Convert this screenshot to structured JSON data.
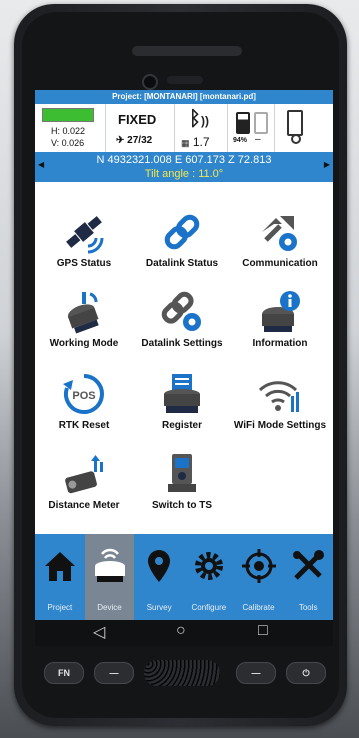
{
  "title_bar": "Project: [MONTANARI] [montanari.pd]",
  "status": {
    "h_value": "H: 0.022",
    "v_value": "V: 0.026",
    "fix_state": "FIXED",
    "satellites": "27/32",
    "pdop": "1.7",
    "battery": "94%",
    "battery2": "–"
  },
  "coords": "N 4932321.008 E 607.173 Z 72.813",
  "tilt": "Tilt angle : 11.0°",
  "menu": [
    {
      "label": "GPS Status",
      "icon": "satellite-icon"
    },
    {
      "label": "Datalink Status",
      "icon": "link-icon"
    },
    {
      "label": "Communication",
      "icon": "communication-gear-icon"
    },
    {
      "label": "Working Mode",
      "icon": "receiver-mode-icon"
    },
    {
      "label": "Datalink Settings",
      "icon": "link-gear-icon"
    },
    {
      "label": "Information",
      "icon": "receiver-info-icon"
    },
    {
      "label": "RTK Reset",
      "icon": "pos-reset-icon"
    },
    {
      "label": "Register",
      "icon": "register-icon"
    },
    {
      "label": "WiFi Mode Settings",
      "icon": "wifi-icon"
    },
    {
      "label": "Distance Meter",
      "icon": "distance-meter-icon"
    },
    {
      "label": "Switch to TS",
      "icon": "total-station-icon"
    }
  ],
  "nav": [
    {
      "label": "Project",
      "icon": "home-icon",
      "active": false
    },
    {
      "label": "Device",
      "icon": "receiver-icon",
      "active": true
    },
    {
      "label": "Survey",
      "icon": "location-pin-icon",
      "active": false
    },
    {
      "label": "Configure",
      "icon": "gear-icon",
      "active": false
    },
    {
      "label": "Calibrate",
      "icon": "crosshair-icon",
      "active": false
    },
    {
      "label": "Tools",
      "icon": "tools-icon",
      "active": false
    }
  ],
  "system_nav": {
    "back": "◁",
    "home": "○",
    "recents": "□"
  },
  "hw_keys": {
    "fn": "FN",
    "minus_left": "—",
    "minus_right": "—",
    "power": "⏻"
  },
  "colors": {
    "accent": "#2f86cc",
    "gauge": "#3cbd32",
    "tilt": "#f4e64d",
    "nav_active": "#7a8694"
  }
}
